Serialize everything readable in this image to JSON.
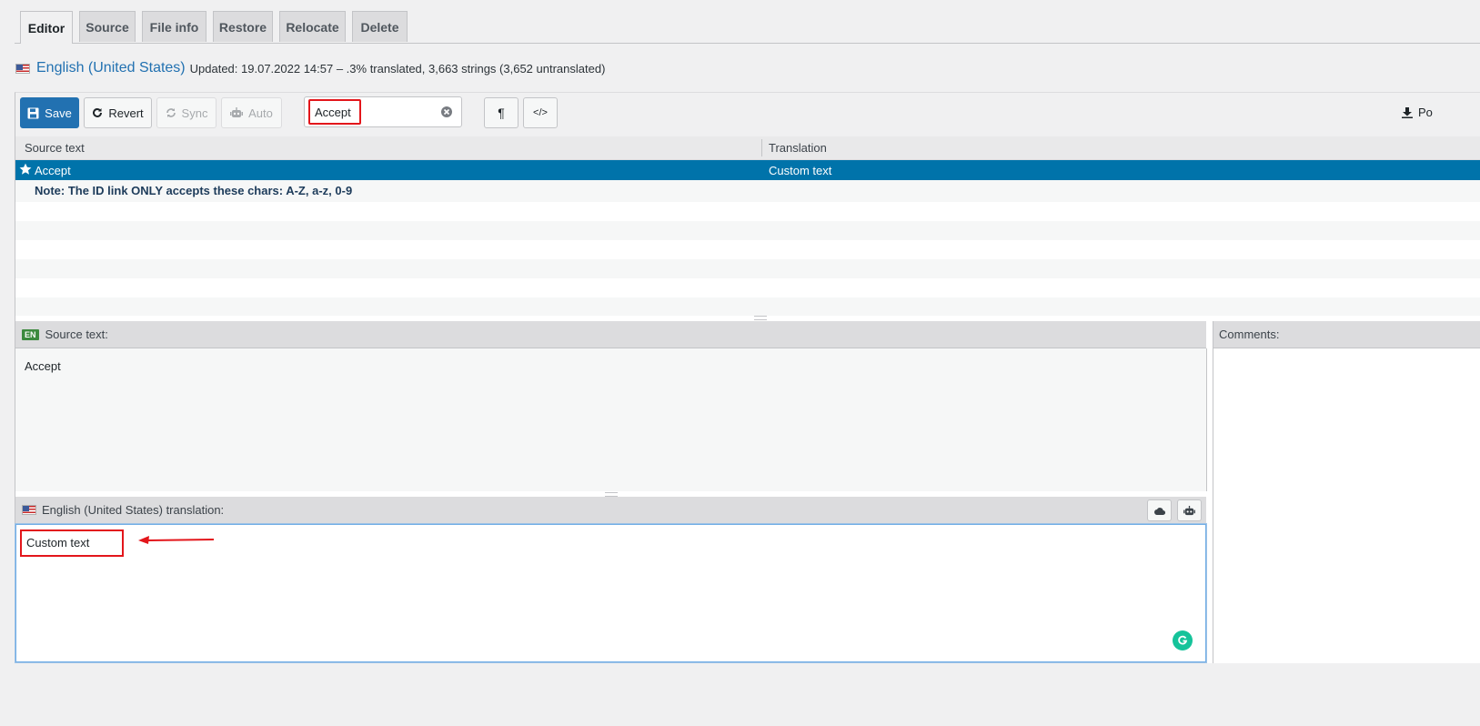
{
  "tabs": [
    {
      "label": "Editor",
      "active": true
    },
    {
      "label": "Source"
    },
    {
      "label": "File info"
    },
    {
      "label": "Restore"
    },
    {
      "label": "Relocate"
    },
    {
      "label": "Delete"
    }
  ],
  "header": {
    "language": "English (United States)",
    "meta": "Updated: 19.07.2022 14:57 – .3% translated, 3,663 strings (3,652 untranslated)"
  },
  "toolbar": {
    "save_label": "Save",
    "revert_label": "Revert",
    "sync_label": "Sync",
    "auto_label": "Auto",
    "search_value": "Accept",
    "pilcrow": "¶",
    "code": "</>",
    "download_label": "Po"
  },
  "grid": {
    "columns": [
      "Source text",
      "Translation"
    ],
    "selected_row": {
      "source": "Accept",
      "translation": "Custom text"
    },
    "note": "Note: The ID link ONLY accepts these chars: A-Z, a-z, 0-9"
  },
  "source_pane": {
    "badge": "EN",
    "title": "Source text:",
    "text": "Accept"
  },
  "comments_pane": {
    "title": "Comments:"
  },
  "translation_pane": {
    "title": "English (United States) translation:",
    "text": "Custom text"
  },
  "colors": {
    "primary": "#2271b1",
    "selected_row": "#0073aa",
    "highlight": "#e3161b",
    "grammarly": "#15c39a"
  }
}
